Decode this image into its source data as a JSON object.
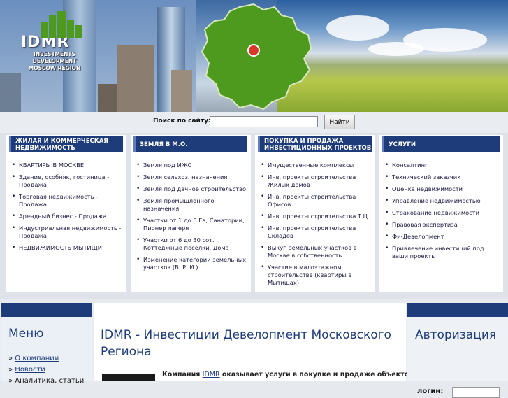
{
  "brand": {
    "logo": "IDMR",
    "tagline_lines": [
      "INVESTMENTS",
      "DEVELOPMENT",
      "MOSCOW REGION"
    ]
  },
  "search": {
    "label": "Поиск по сайту:",
    "value": "",
    "button": "Найти"
  },
  "categories": [
    {
      "title": "ЖИЛАЯ И КОММЕРЧЕСКАЯ НЕДВИЖИМОСТЬ",
      "items": [
        "КВАРТИРЫ В МОСКВЕ",
        "Здание, особняк, гостиница - Продажа",
        "Торговая недвижимость - Продажа",
        "Арендный бизнес - Продажа",
        "Индустриальная недвижимость - Продажа",
        "НЕДВИЖИМОСТЬ МЫТИЩИ"
      ]
    },
    {
      "title": "ЗЕМЛЯ В М.О.",
      "items": [
        "Земля под ИЖС",
        "Земля сельхоз. назначения",
        "Земля под дачное строительство",
        "Земля промышленного назначения",
        "Участки от 1 до 5 Га, Санатории, Пионер лагеря",
        "Участки от 6 до 30 сот. , Коттеджные поселки, Дома",
        "Изменение категории земельных участков (В. Р. И.)"
      ]
    },
    {
      "title": "ПОКУПКА И ПРОДАЖА ИНВЕСТИЦИОННЫХ ПРОЕКТОВ",
      "items": [
        "Имущественные комплексы",
        "Инв. проекты строительства Жилых домов",
        "Инв. проекты строительства Офисов",
        "Инв. проекты строительства Т.Ц.",
        "Инв. проекты строительства Складов",
        "Выкуп земельных участков в Москве в собственность",
        "Участие в малоэтажном строительстве (квартиры в Мытищах)"
      ]
    },
    {
      "title": "УСЛУГИ",
      "items": [
        "Консалтинг",
        "Технический заказчик",
        "Оценка недвижимости",
        "Управление недвижимостью",
        "Страхование недвижимости",
        "Правовая экспертиза",
        "Фи-Девелопмент",
        "Привлечение инвестиций под ваши проекты"
      ]
    }
  ],
  "menu": {
    "title": "Меню",
    "items": [
      "О компании",
      "Новости",
      "Аналитика, статьи"
    ]
  },
  "main": {
    "title": "IDMR - Инвестиции Девелопмент Московского Региона",
    "intro_prefix": "Компания ",
    "intro_link": "IDMR",
    "intro_suffix": " оказывает услуги в покупке и продаже объектов"
  },
  "auth": {
    "title": "Авторизация",
    "login_label": "логин:"
  },
  "colors": {
    "accent": "#1f3c7a",
    "map_green": "#4e9a1f",
    "marker": "#d8382a"
  }
}
